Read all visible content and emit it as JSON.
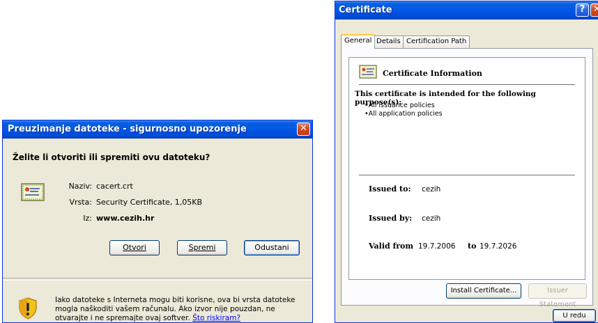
{
  "download_dialog": {
    "title": "Preuzimanje datoteke - sigurnosno upozorenje",
    "question": "Želite li otvoriti ili spremiti ovu datoteku?",
    "fields": {
      "name_label": "Naziv:",
      "name_value": "cacert.crt",
      "type_label": "Vrsta:",
      "type_value": "Security Certificate, 1,05KB",
      "from_label": "Iz:",
      "from_value": "www.cezih.hr"
    },
    "buttons": {
      "open": "Otvori",
      "save": "Spremi",
      "cancel": "Odustani"
    },
    "warning_text": "Iako datoteke s Interneta mogu biti korisne, ova bi vrsta datoteke mogla naškoditi vašem računalu. Ako izvor nije pouzdan, ne otvarajte i ne spremajte ovaj softver.",
    "warning_link": "Što riskiram?",
    "close_glyph": "✕"
  },
  "certificate_dialog": {
    "title": "Certificate",
    "help_glyph": "?",
    "close_glyph": "✕",
    "tabs": [
      "General",
      "Details",
      "Certification Path"
    ],
    "info_heading": "Certificate Information",
    "purpose_heading": "This certificate is intended for the following purpose(s):",
    "purposes": [
      "•All issuance policies",
      "•All application policies"
    ],
    "issued_to_label": "Issued to:",
    "issued_to_value": "cezih",
    "issued_by_label": "Issued by:",
    "issued_by_value": "cezih",
    "valid_from_label": "Valid from",
    "valid_from_value": "19.7.2006",
    "valid_to_label": "to",
    "valid_to_value": "19.7.2026",
    "buttons": {
      "install": "Install Certificate...",
      "issuer_statement": "Issuer Statement",
      "ok": "U redu"
    }
  }
}
